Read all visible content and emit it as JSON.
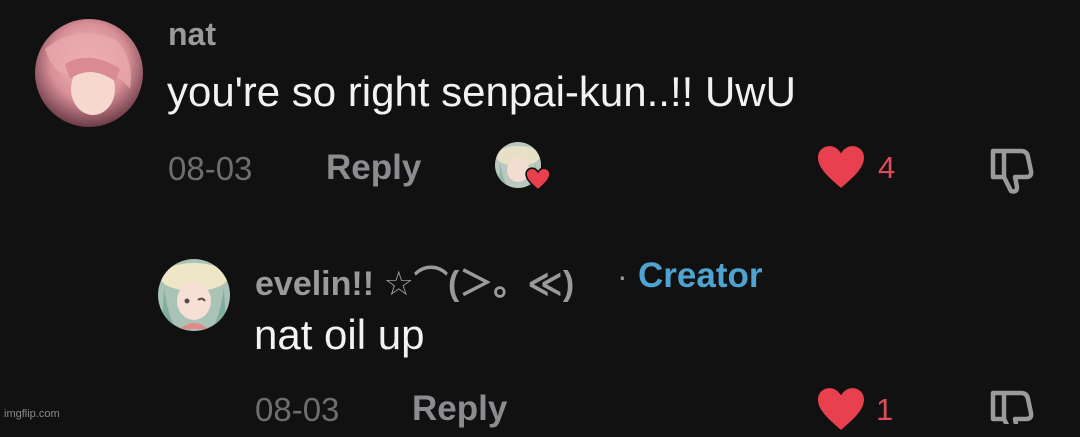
{
  "comments": [
    {
      "username": "nat",
      "text": "you're so right senpai-kun..!! UwU",
      "date": "08-03",
      "reply_label": "Reply",
      "like_count": "4",
      "creator_liked": true
    },
    {
      "username": "evelin!! ☆⌒(＞。≪)",
      "separator": "·",
      "role_badge": "Creator",
      "text": "nat oil up",
      "date": "08-03",
      "reply_label": "Reply",
      "like_count": "1"
    }
  ],
  "watermark": "imgflip.com",
  "colors": {
    "background": "#111112",
    "like_red": "#e8404f",
    "creator_blue": "#4ea3d1",
    "username_gray": "#9a9a9c"
  },
  "icons": [
    "heart-icon",
    "dislike-icon",
    "creator-liked-heart-icon"
  ]
}
